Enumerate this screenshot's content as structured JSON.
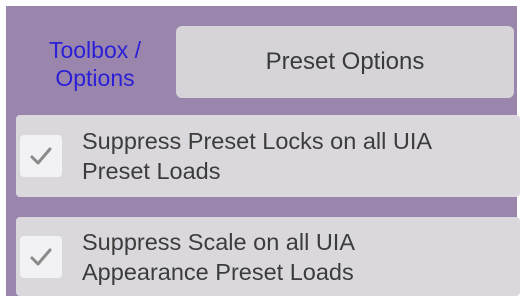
{
  "tabs": {
    "toolbox_line1": "Toolbox /",
    "toolbox_line2": "Options",
    "preset_options": "Preset Options"
  },
  "options": [
    {
      "line1": "Suppress Preset Locks on all UIA",
      "line2": "Preset Loads",
      "checked": true
    },
    {
      "line1": "Suppress Scale on all UIA",
      "line2": "Appearance Preset Loads",
      "checked": true
    }
  ],
  "colors": {
    "panel_bg": "#9a86ad",
    "link": "#2a1fd6",
    "button_bg": "#d6d4d8"
  }
}
